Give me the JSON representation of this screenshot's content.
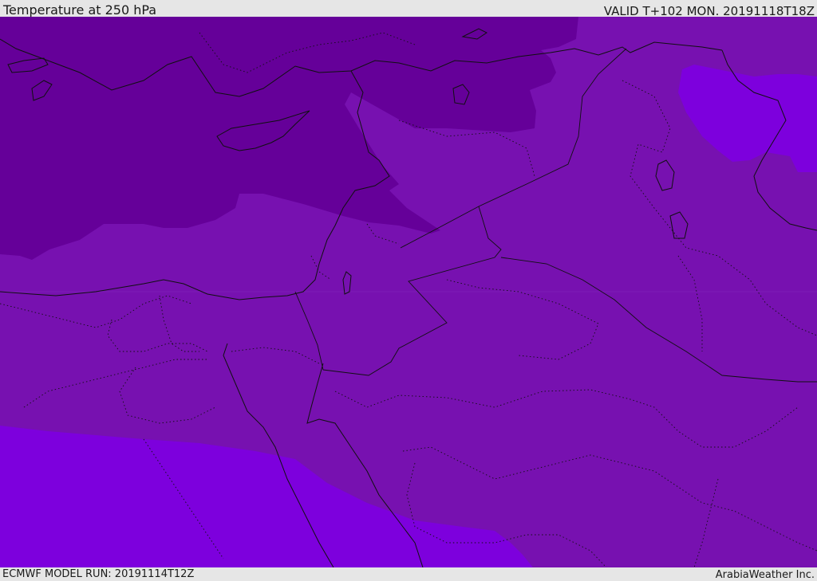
{
  "header": {
    "title": "Temperature at 250 hPa",
    "valid": "VALID T+102 MON. 20191118T18Z"
  },
  "footer": {
    "model_run": "ECMWF MODEL RUN: 20191114T12Z",
    "credit": "ArabiaWeather Inc."
  },
  "map": {
    "colors": {
      "coldest": "#650099",
      "cold": "#7711b0",
      "cool_bright": "#7d00dd",
      "coastline": "#101010"
    }
  }
}
